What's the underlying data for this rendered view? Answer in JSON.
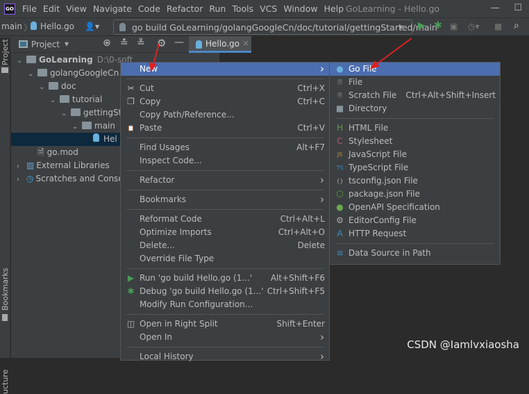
{
  "window": {
    "title": "GoLearning - Hello.go",
    "logo": "GO"
  },
  "menubar": [
    "File",
    "Edit",
    "View",
    "Navigate",
    "Code",
    "Refactor",
    "Run",
    "Tools",
    "VCS",
    "Window",
    "Help"
  ],
  "navbar": {
    "crumb1": "main",
    "crumb2": "Hello.go",
    "run_config": "go build GoLearning/golangGoogleCn/doc/tutorial/gettingStarted/main"
  },
  "sidestripe": {
    "project": "Project",
    "bookmarks": "Bookmarks",
    "structure": "ucture"
  },
  "project_panel": {
    "title": "Project",
    "tab": "Hello.go"
  },
  "tree": [
    {
      "label": "GoLearning",
      "extra": "D:\\0-soft",
      "depth": 0,
      "type": "folder",
      "open": true
    },
    {
      "label": "golangGoogleCn",
      "depth": 1,
      "type": "folder",
      "open": true
    },
    {
      "label": "doc",
      "depth": 2,
      "type": "folder",
      "open": true
    },
    {
      "label": "tutorial",
      "depth": 3,
      "type": "folder",
      "open": true
    },
    {
      "label": "gettingSta",
      "depth": 4,
      "type": "folder",
      "open": true
    },
    {
      "label": "main",
      "depth": 5,
      "type": "folder",
      "open": true
    },
    {
      "label": "Hel",
      "depth": 6,
      "type": "go",
      "selected": true
    },
    {
      "label": "go.mod",
      "depth": 1,
      "type": "file"
    },
    {
      "label": "External Libraries",
      "depth": 0,
      "type": "lib",
      "open": false
    },
    {
      "label": "Scratches and Console",
      "depth": 0,
      "type": "scratch",
      "open": false
    }
  ],
  "context_menu": [
    {
      "label": "New",
      "submenu": true,
      "selected": true
    },
    {
      "sep": true
    },
    {
      "label": "Cut",
      "shortcut": "Ctrl+X",
      "icon": "scissors-icon"
    },
    {
      "label": "Copy",
      "shortcut": "Ctrl+C",
      "icon": "copy-icon"
    },
    {
      "label": "Copy Path/Reference..."
    },
    {
      "label": "Paste",
      "shortcut": "Ctrl+V",
      "icon": "paste-icon"
    },
    {
      "sep": true
    },
    {
      "label": "Find Usages",
      "shortcut": "Alt+F7"
    },
    {
      "label": "Inspect Code..."
    },
    {
      "sep": true
    },
    {
      "label": "Refactor",
      "submenu": true
    },
    {
      "sep": true
    },
    {
      "label": "Bookmarks",
      "submenu": true
    },
    {
      "sep": true
    },
    {
      "label": "Reformat Code",
      "shortcut": "Ctrl+Alt+L"
    },
    {
      "label": "Optimize Imports",
      "shortcut": "Ctrl+Alt+O"
    },
    {
      "label": "Delete...",
      "shortcut": "Delete"
    },
    {
      "label": "Override File Type"
    },
    {
      "sep": true
    },
    {
      "label": "Run 'go build Hello.go (1...'",
      "shortcut": "Alt+Shift+F6",
      "icon": "run-icon"
    },
    {
      "label": "Debug 'go build Hello.go (1...'",
      "shortcut": "Ctrl+Shift+F5",
      "icon": "debug-icon"
    },
    {
      "label": "Modify Run Configuration..."
    },
    {
      "sep": true
    },
    {
      "label": "Open in Right Split",
      "shortcut": "Shift+Enter",
      "icon": "split-icon"
    },
    {
      "label": "Open In",
      "submenu": true
    },
    {
      "sep": true
    },
    {
      "label": "Local History",
      "submenu": true
    }
  ],
  "new_submenu": [
    {
      "label": "Go File",
      "icon": "gopher-icon",
      "selected": true
    },
    {
      "label": "File",
      "icon": "file-icon"
    },
    {
      "label": "Scratch File",
      "shortcut": "Ctrl+Alt+Shift+Insert",
      "icon": "scratch-file-icon"
    },
    {
      "label": "Directory",
      "icon": "folder-icon"
    },
    {
      "sep": true
    },
    {
      "label": "HTML File",
      "icon": "html-file-icon"
    },
    {
      "label": "Stylesheet",
      "icon": "css-file-icon"
    },
    {
      "label": "JavaScript File",
      "icon": "js-file-icon"
    },
    {
      "label": "TypeScript File",
      "icon": "ts-file-icon"
    },
    {
      "label": "tsconfig.json File",
      "icon": "json-file-icon"
    },
    {
      "label": "package.json File",
      "icon": "nodejs-icon"
    },
    {
      "label": "OpenAPI Specification",
      "icon": "openapi-icon"
    },
    {
      "label": "EditorConfig File",
      "icon": "gear-icon"
    },
    {
      "label": "HTTP Request",
      "icon": "api-file-icon"
    },
    {
      "sep": true
    },
    {
      "label": "Data Source in Path",
      "icon": "database-icon"
    }
  ],
  "watermark": "CSDN @Iamlvxiaosha",
  "colors": {
    "selection": "#4b6eaf",
    "annotation_arrow": "#e02020",
    "run_green": "#499c54"
  }
}
